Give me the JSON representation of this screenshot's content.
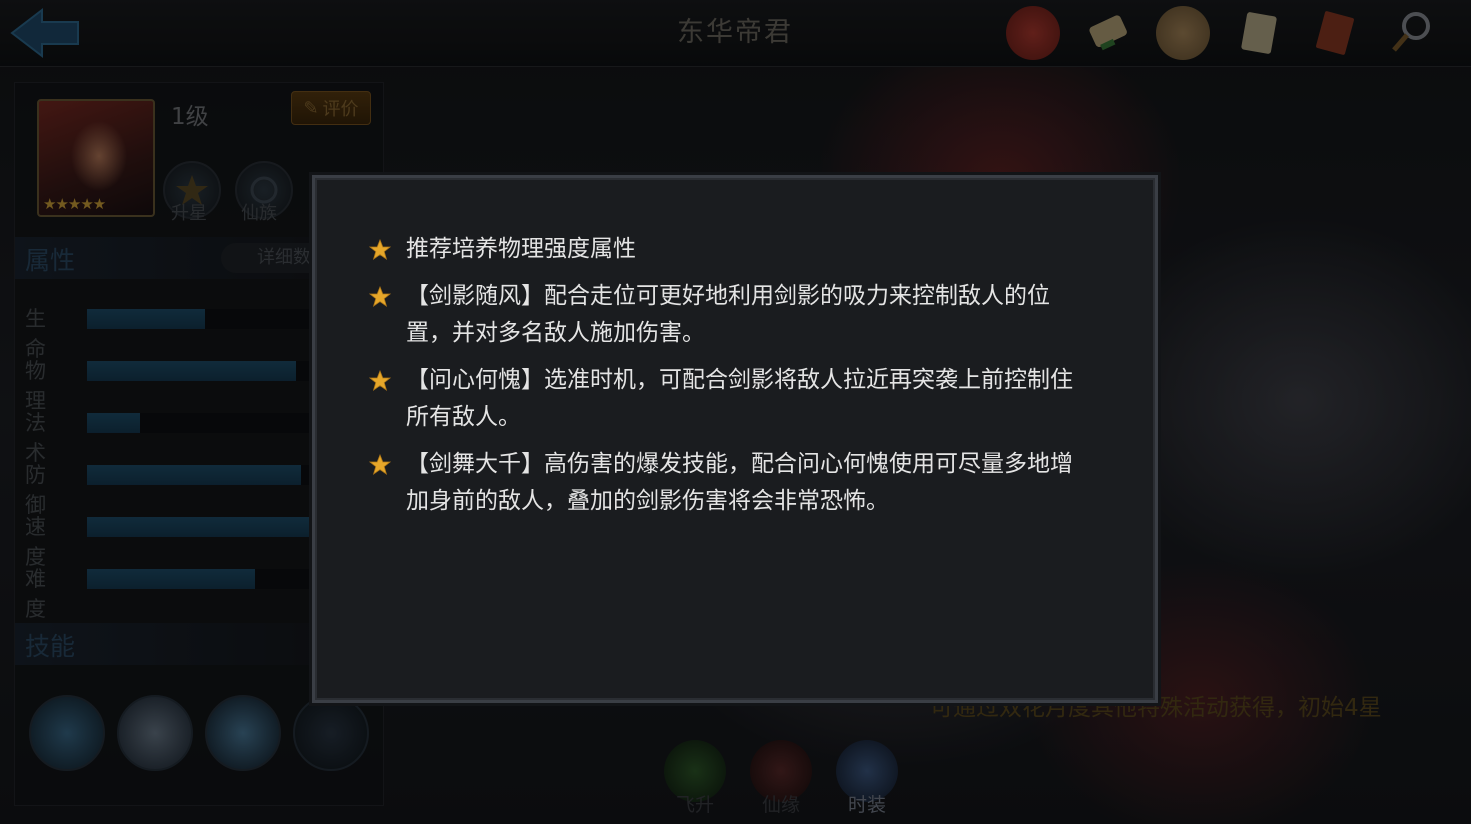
{
  "header": {
    "title": "东华帝君",
    "icons": [
      "battle-seal-icon",
      "scroll-icon",
      "medal-icon",
      "document-icon",
      "book-icon",
      "magnifier-icon"
    ]
  },
  "hero": {
    "level": "1级",
    "rate_label": "评价",
    "star_rating": "★★★★★",
    "buttons": [
      {
        "label": "升星",
        "icon": "upgrade-star-icon"
      },
      {
        "label": "仙族",
        "icon": "yin-yang-icon"
      }
    ]
  },
  "attributes": {
    "title": "属性",
    "detail_label": "详细数",
    "stats": [
      {
        "label": "生命",
        "level": 0.49
      },
      {
        "label": "物理",
        "level": 0.87
      },
      {
        "label": "法术",
        "level": 0.22
      },
      {
        "label": "防御",
        "level": 0.89
      },
      {
        "label": "速度",
        "level": 1.0
      },
      {
        "label": "难度",
        "level": 0.7
      }
    ]
  },
  "skills": {
    "title": "技能",
    "icons": [
      "sword-shadow-skill-icon",
      "warrior-skill-icon",
      "whirl-skill-icon",
      "dark-skill-icon"
    ]
  },
  "bottom_tabs": [
    {
      "label": "飞升",
      "color": "#2f5a2a"
    },
    {
      "label": "仙缘",
      "color": "#5a2a2a"
    },
    {
      "label": "时装",
      "color": "#2e3e5c"
    }
  ],
  "hint": "可通过双花月度其他特殊活动获得，初始4星",
  "tips_modal": {
    "tips": [
      "推荐培养物理强度属性",
      "【剑影随风】配合走位可更好地利用剑影的吸力来控制敌人的位置，并对多名敌人施加伤害。",
      "【问心何愧】选准时机，可配合剑影将敌人拉近再突袭上前控制住所有敌人。",
      "【剑舞大千】高伤害的爆发技能，配合问心何愧使用可尽量多地增加身前的敌人，叠加的剑影伤害将会非常恐怖。"
    ]
  },
  "colors": {
    "star": "#e6a72a",
    "modal_bg": "#1a1c1f",
    "tip_text": "#e4e4e4"
  }
}
